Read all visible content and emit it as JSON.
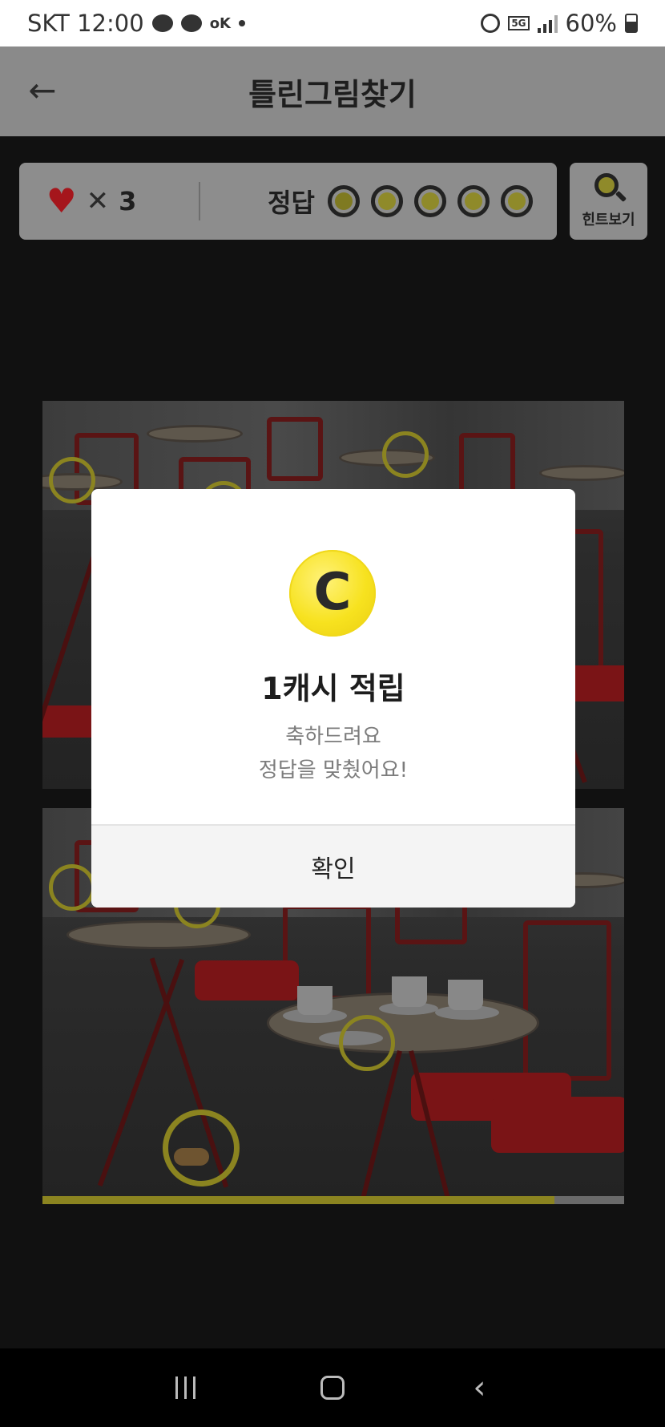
{
  "status_bar": {
    "carrier_time": "SKT 12:00",
    "ok_badge": "oK",
    "network": "5G",
    "battery": "60%",
    "icons": [
      "chat-bubble-icon",
      "message-icon",
      "ok-badge-icon",
      "dot-icon",
      "alarm-icon",
      "5g-icon",
      "signal-icon",
      "battery-icon"
    ]
  },
  "header": {
    "title": "틀린그림찾기",
    "back_icon": "arrow-left-icon"
  },
  "game": {
    "lives_icon": "heart-icon",
    "lives_times": "✕",
    "lives_count": "3",
    "answers_label": "정답",
    "answer_slots": 5,
    "hint_label": "힌트보기",
    "hint_icon": "magnifier-icon",
    "progress": 0.88
  },
  "modal": {
    "coin_letter": "C",
    "title": "1캐시 적립",
    "message_line1": "축하드려요",
    "message_line2": "정답을 맞췄어요!",
    "confirm_label": "확인"
  },
  "colors": {
    "accent": "#8b8420",
    "coin": "#f7e21f",
    "heart": "#a5161c"
  },
  "nav": {
    "icons": [
      "recents-icon",
      "home-icon",
      "back-icon"
    ]
  }
}
